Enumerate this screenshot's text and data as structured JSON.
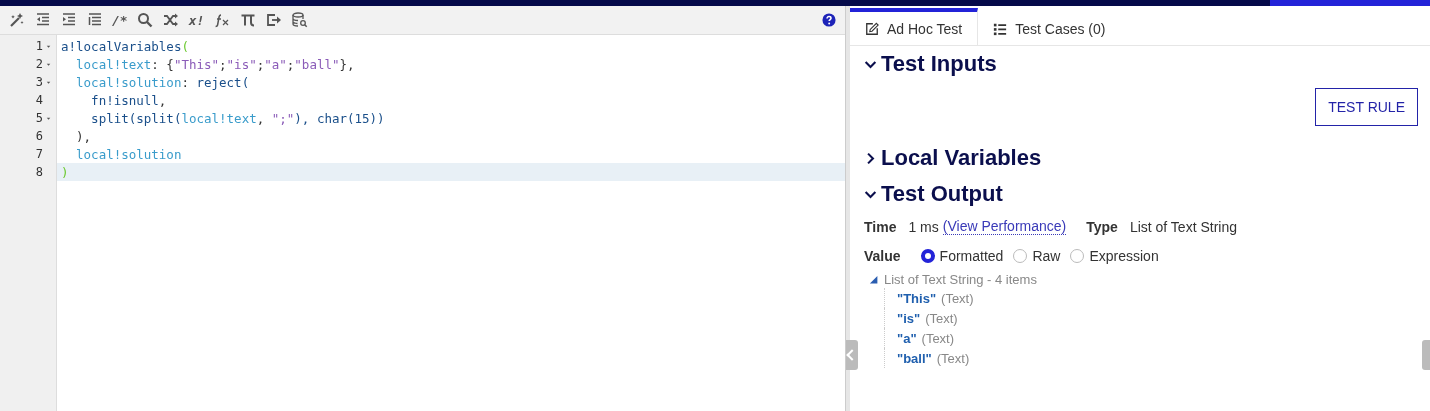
{
  "toolbar": {
    "tools": [
      {
        "kind": "wand"
      },
      {
        "kind": "outdent"
      },
      {
        "kind": "indent"
      },
      {
        "kind": "lines"
      },
      {
        "kind": "text",
        "text": "/*"
      },
      {
        "kind": "search"
      },
      {
        "kind": "shuffle"
      },
      {
        "kind": "text",
        "text": "x!"
      },
      {
        "kind": "fx"
      },
      {
        "kind": "pi"
      },
      {
        "kind": "export"
      },
      {
        "kind": "database"
      }
    ],
    "help": {
      "kind": "help"
    }
  },
  "editor": {
    "lines": [
      {
        "number": "1",
        "foldable": true,
        "active": false,
        "tokens": [
          {
            "text": "a!localVariables",
            "kind": "fn"
          },
          {
            "text": "(",
            "kind": "bracket"
          }
        ]
      },
      {
        "number": "2",
        "foldable": true,
        "active": false,
        "tokens": [
          {
            "text": "  local!text",
            "kind": "var"
          },
          {
            "text": ": {",
            "kind": "punct"
          },
          {
            "text": "\"This\"",
            "kind": "str"
          },
          {
            "text": ";",
            "kind": "punct"
          },
          {
            "text": "\"is\"",
            "kind": "str"
          },
          {
            "text": ";",
            "kind": "punct"
          },
          {
            "text": "\"a\"",
            "kind": "str"
          },
          {
            "text": ";",
            "kind": "punct"
          },
          {
            "text": "\"ball\"",
            "kind": "str"
          },
          {
            "text": "},",
            "kind": "punct"
          }
        ]
      },
      {
        "number": "3",
        "foldable": true,
        "active": false,
        "tokens": [
          {
            "text": "  local!solution",
            "kind": "var"
          },
          {
            "text": ": ",
            "kind": "punct"
          },
          {
            "text": "reject(",
            "kind": "fn"
          }
        ]
      },
      {
        "number": "4",
        "foldable": false,
        "active": false,
        "tokens": [
          {
            "text": "    fn!isnull",
            "kind": "fn"
          },
          {
            "text": ",",
            "kind": "punct"
          }
        ]
      },
      {
        "number": "5",
        "foldable": true,
        "active": false,
        "tokens": [
          {
            "text": "    split(split(",
            "kind": "fn"
          },
          {
            "text": "local!text",
            "kind": "var"
          },
          {
            "text": ", ",
            "kind": "punct"
          },
          {
            "text": "\";\"",
            "kind": "str"
          },
          {
            "text": "), ",
            "kind": "fn"
          },
          {
            "text": "char(15))",
            "kind": "fn"
          }
        ]
      },
      {
        "number": "6",
        "foldable": false,
        "active": false,
        "tokens": [
          {
            "text": "  ),",
            "kind": "punct"
          }
        ]
      },
      {
        "number": "7",
        "foldable": false,
        "active": false,
        "tokens": [
          {
            "text": "  local!solution",
            "kind": "var"
          }
        ]
      },
      {
        "number": "8",
        "foldable": false,
        "active": true,
        "tokens": [
          {
            "text": ")",
            "kind": "bracket"
          }
        ]
      }
    ]
  },
  "tabs": [
    {
      "label": "Ad Hoc Test",
      "selected": true
    },
    {
      "label": "Test Cases (0)",
      "selected": false
    }
  ],
  "sections": [
    {
      "title": "Test Inputs",
      "expanded": true,
      "kind": "inputs",
      "button": "TEST RULE"
    },
    {
      "title": "Local Variables",
      "expanded": false
    },
    {
      "title": "Test Output",
      "expanded": true,
      "kind": "output",
      "time_label": "Time",
      "time": "1 ms",
      "link": "(View Performance)",
      "type_label": "Type",
      "type": "List of Text String",
      "value_label": "Value",
      "options": [
        {
          "label": "Formatted",
          "selected": true
        },
        {
          "label": "Raw",
          "selected": false
        },
        {
          "label": "Expression",
          "selected": false
        }
      ],
      "tree": {
        "label": "List of Text String - 4 items",
        "expanded": true,
        "children": [
          {
            "value": "\"This\"",
            "type": "(Text)"
          },
          {
            "value": "\"is\"",
            "type": "(Text)"
          },
          {
            "value": "\"a\"",
            "type": "(Text)"
          },
          {
            "value": "\"ball\"",
            "type": "(Text)"
          }
        ]
      }
    }
  ]
}
